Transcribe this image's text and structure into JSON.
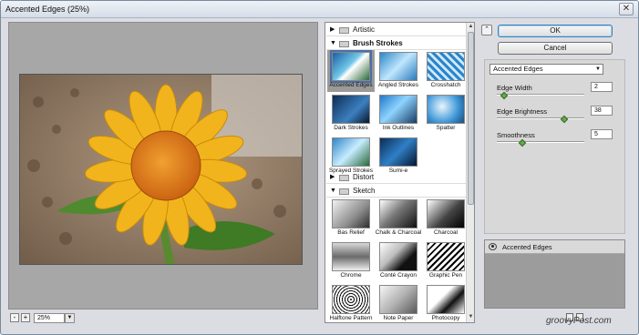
{
  "window": {
    "title": "Accented Edges (25%)"
  },
  "preview": {
    "zoom": "25%",
    "zoom_in_symbol": "+",
    "zoom_out_symbol": "-"
  },
  "gallery": {
    "folders": [
      {
        "label": "Artistic",
        "expanded": false
      },
      {
        "label": "Brush Strokes",
        "expanded": true,
        "filters": [
          "Accented Edges",
          "Angled Strokes",
          "Crosshatch",
          "Dark Strokes",
          "Ink Outlines",
          "Spatter",
          "Sprayed Strokes",
          "Sumi-e"
        ],
        "selected": "Accented Edges"
      },
      {
        "label": "Distort",
        "expanded": false
      },
      {
        "label": "Sketch",
        "expanded": true,
        "filters": [
          "Bas Relief",
          "Chalk & Charcoal",
          "Charcoal",
          "Chrome",
          "Conté Crayon",
          "Graphic Pen",
          "Halftone Pattern",
          "Note Paper",
          "Photocopy"
        ]
      }
    ]
  },
  "buttons": {
    "ok": "OK",
    "cancel": "Cancel",
    "collapse_symbol": "⌃"
  },
  "settings": {
    "selected_filter": "Accented Edges",
    "params": [
      {
        "label": "Edge Width",
        "value": "2",
        "level": 0.05
      },
      {
        "label": "Edge Brightness",
        "value": "38",
        "level": 0.76
      },
      {
        "label": "Smoothness",
        "value": "5",
        "level": 0.27
      }
    ]
  },
  "layers": {
    "items": [
      {
        "label": "Accented Edges"
      }
    ]
  },
  "brand": "groovyPost.com"
}
